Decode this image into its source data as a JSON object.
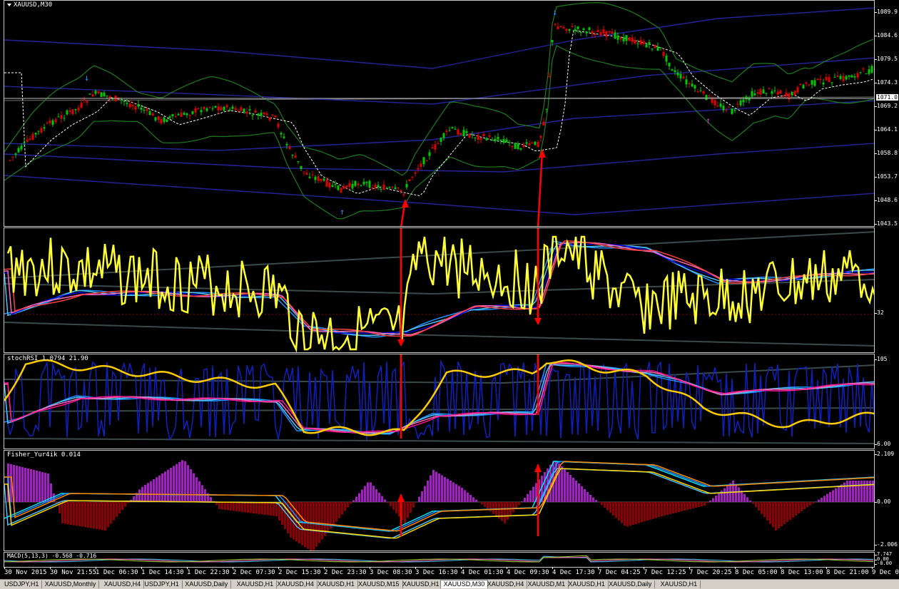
{
  "main_pane": {
    "label": "XAUUSD,M30",
    "price_tag": "1071.0",
    "price_scale": [
      "1089.9",
      "1084.6",
      "1079.5",
      "1074.3",
      "1069.2",
      "1064.1",
      "1058.8",
      "1053.7",
      "1048.6",
      "1043.5"
    ]
  },
  "rsi_pane": {
    "label": "",
    "level": "32"
  },
  "stoch_pane": {
    "label": "stochRSI 1.0794 21.90",
    "top": "105",
    "bottom": "6.00"
  },
  "fisher_pane": {
    "label": "Fisher_Yur4ik 0.014",
    "top": "2.109",
    "mid": "0.00",
    "bottom": "-2.006"
  },
  "macd_pane": {
    "label": "MACD(5,13,3) -0.568 -0.716",
    "top": "7.747",
    "mid": "0.00",
    "bottom": "-8.00"
  },
  "time_axis": [
    "30 Nov 2015",
    "30 Nov 21:55",
    "1 Dec 06:30",
    "1 Dec 14:30",
    "1 Dec 22:30",
    "2 Dec 07:30",
    "2 Dec 15:30",
    "2 Dec 23:30",
    "3 Dec 08:30",
    "3 Dec 16:30",
    "4 Dec 01:30",
    "4 Dec 09:30",
    "4 Dec 17:30",
    "7 Dec 04:25",
    "7 Dec 12:25",
    "7 Dec 20:25",
    "8 Dec 05:00",
    "8 Dec 13:00",
    "8 Dec 21:00",
    "9 Dec 06"
  ],
  "tabs": [
    "USDJPY,H1",
    "XAUUSD,Monthly",
    "XAUUSD,H4",
    "USDJPY,H1",
    "XAUUSD,Daily",
    "XAUUSD,H1",
    "XAUUSD,H4",
    "XAUUSD,H1",
    "XAUUSD,M15",
    "XAUUSD,H1",
    "XAUUSD,M30",
    "XAUUSD,H4",
    "XAUUSD,M1",
    "XAUUSD,H1",
    "XAUUSD,Daily",
    "XAUUSD,H1"
  ],
  "active_tab": 10,
  "colors": {
    "bull": "#00c800",
    "bear": "#e00000",
    "bollinger": "#1e7a1e",
    "envelope": "#1e1e96",
    "rsi": "#ffff33",
    "arrow": "#ff0000",
    "hist_pos": "#a020c0",
    "hist_neg": "#8b0000"
  }
}
